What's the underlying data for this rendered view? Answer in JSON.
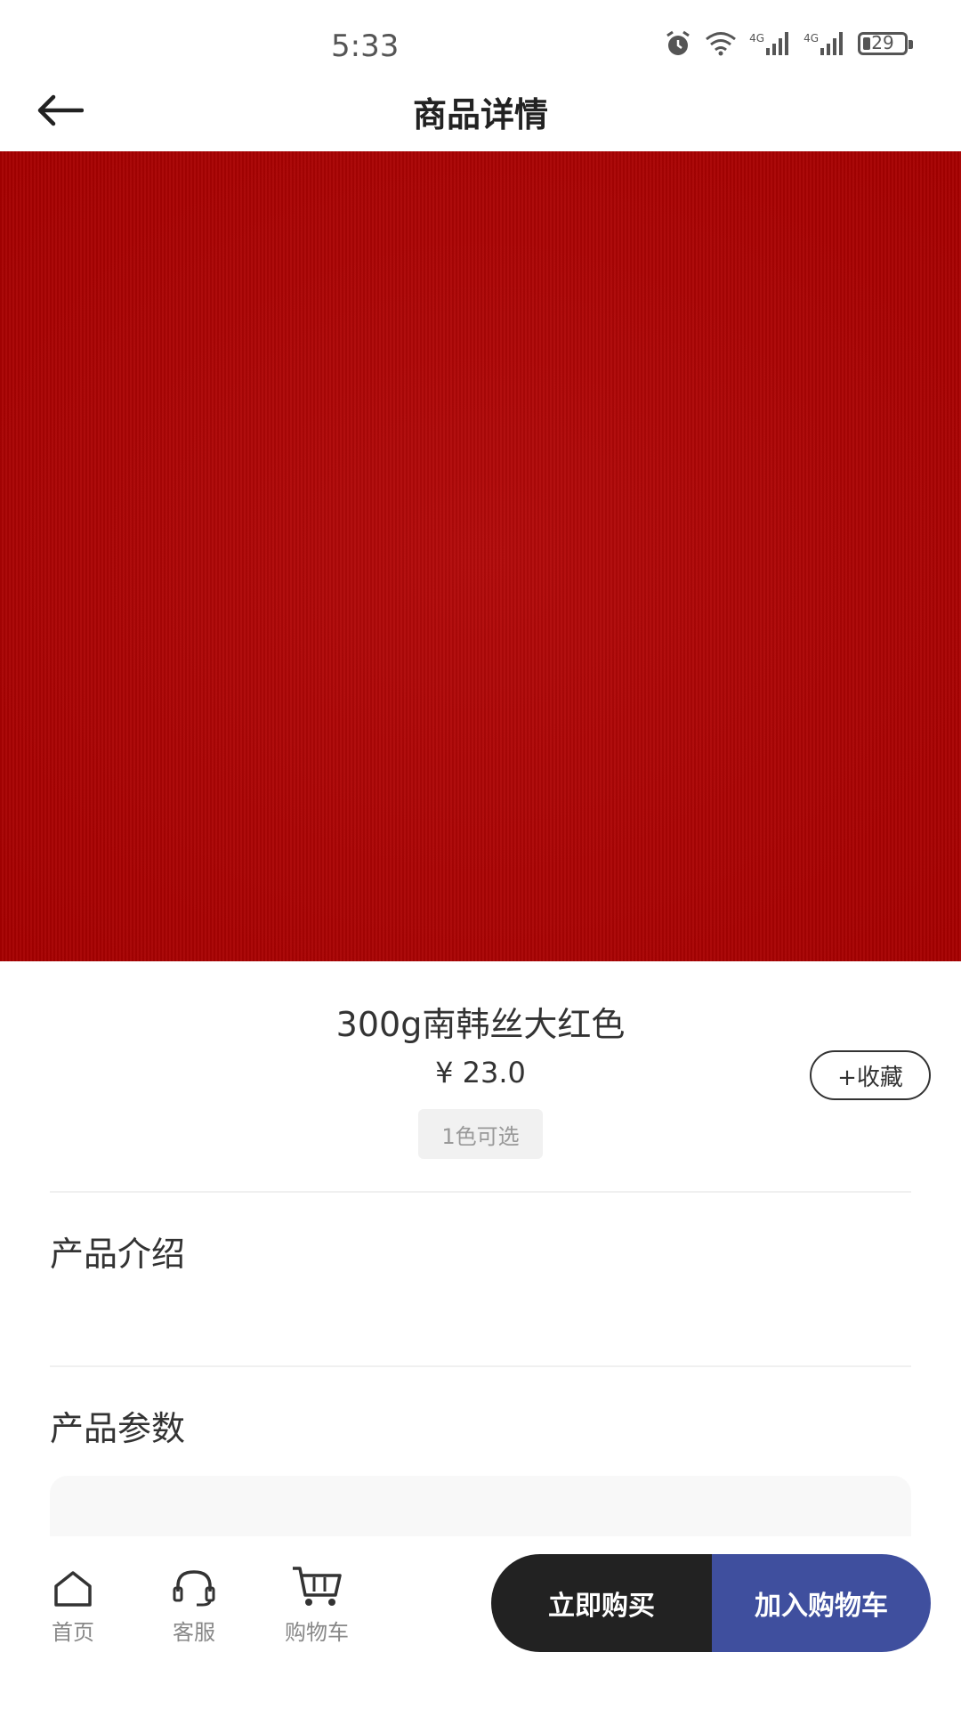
{
  "status_bar": {
    "time": "5:33",
    "network_1": "4G",
    "network_2": "4G",
    "battery": "29"
  },
  "header": {
    "title": "商品详情",
    "back_icon": "arrow-left-icon"
  },
  "product": {
    "image_color": "#b00000",
    "name": "300g南韩丝大红色",
    "price": "¥ 23.0",
    "color_tag": "1色可选",
    "favorite_label": "+收藏"
  },
  "sections": {
    "intro_title": "产品介绍",
    "params_title": "产品参数"
  },
  "bottom_nav": {
    "items": [
      {
        "label": "首页",
        "icon": "home-icon"
      },
      {
        "label": "客服",
        "icon": "headset-icon"
      },
      {
        "label": "购物车",
        "icon": "cart-icon"
      }
    ],
    "buy_now_label": "立即购买",
    "add_to_cart_label": "加入购物车",
    "buy_now_color": "#222222",
    "add_to_cart_color": "#3f4f9e"
  }
}
